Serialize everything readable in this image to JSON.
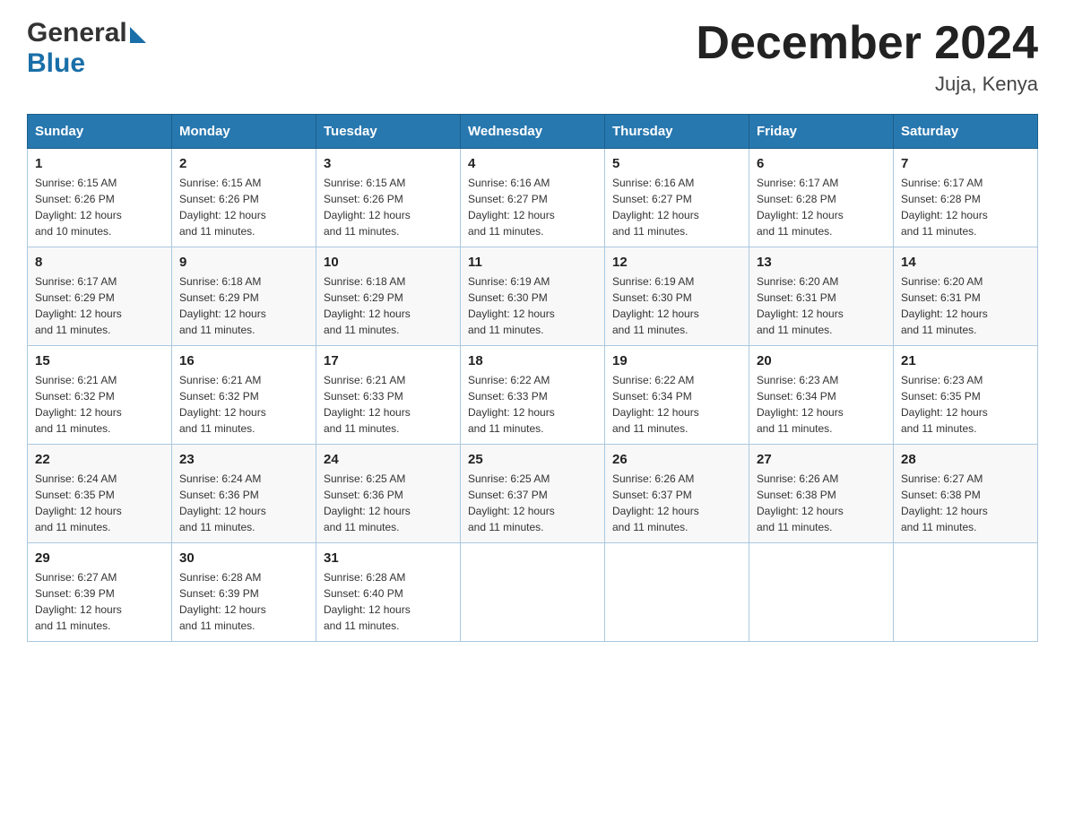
{
  "header": {
    "title": "December 2024",
    "location": "Juja, Kenya",
    "logo_general": "General",
    "logo_blue": "Blue"
  },
  "calendar": {
    "weekdays": [
      "Sunday",
      "Monday",
      "Tuesday",
      "Wednesday",
      "Thursday",
      "Friday",
      "Saturday"
    ],
    "weeks": [
      [
        {
          "day": "1",
          "sunrise": "6:15 AM",
          "sunset": "6:26 PM",
          "daylight": "12 hours and 10 minutes."
        },
        {
          "day": "2",
          "sunrise": "6:15 AM",
          "sunset": "6:26 PM",
          "daylight": "12 hours and 11 minutes."
        },
        {
          "day": "3",
          "sunrise": "6:15 AM",
          "sunset": "6:26 PM",
          "daylight": "12 hours and 11 minutes."
        },
        {
          "day": "4",
          "sunrise": "6:16 AM",
          "sunset": "6:27 PM",
          "daylight": "12 hours and 11 minutes."
        },
        {
          "day": "5",
          "sunrise": "6:16 AM",
          "sunset": "6:27 PM",
          "daylight": "12 hours and 11 minutes."
        },
        {
          "day": "6",
          "sunrise": "6:17 AM",
          "sunset": "6:28 PM",
          "daylight": "12 hours and 11 minutes."
        },
        {
          "day": "7",
          "sunrise": "6:17 AM",
          "sunset": "6:28 PM",
          "daylight": "12 hours and 11 minutes."
        }
      ],
      [
        {
          "day": "8",
          "sunrise": "6:17 AM",
          "sunset": "6:29 PM",
          "daylight": "12 hours and 11 minutes."
        },
        {
          "day": "9",
          "sunrise": "6:18 AM",
          "sunset": "6:29 PM",
          "daylight": "12 hours and 11 minutes."
        },
        {
          "day": "10",
          "sunrise": "6:18 AM",
          "sunset": "6:29 PM",
          "daylight": "12 hours and 11 minutes."
        },
        {
          "day": "11",
          "sunrise": "6:19 AM",
          "sunset": "6:30 PM",
          "daylight": "12 hours and 11 minutes."
        },
        {
          "day": "12",
          "sunrise": "6:19 AM",
          "sunset": "6:30 PM",
          "daylight": "12 hours and 11 minutes."
        },
        {
          "day": "13",
          "sunrise": "6:20 AM",
          "sunset": "6:31 PM",
          "daylight": "12 hours and 11 minutes."
        },
        {
          "day": "14",
          "sunrise": "6:20 AM",
          "sunset": "6:31 PM",
          "daylight": "12 hours and 11 minutes."
        }
      ],
      [
        {
          "day": "15",
          "sunrise": "6:21 AM",
          "sunset": "6:32 PM",
          "daylight": "12 hours and 11 minutes."
        },
        {
          "day": "16",
          "sunrise": "6:21 AM",
          "sunset": "6:32 PM",
          "daylight": "12 hours and 11 minutes."
        },
        {
          "day": "17",
          "sunrise": "6:21 AM",
          "sunset": "6:33 PM",
          "daylight": "12 hours and 11 minutes."
        },
        {
          "day": "18",
          "sunrise": "6:22 AM",
          "sunset": "6:33 PM",
          "daylight": "12 hours and 11 minutes."
        },
        {
          "day": "19",
          "sunrise": "6:22 AM",
          "sunset": "6:34 PM",
          "daylight": "12 hours and 11 minutes."
        },
        {
          "day": "20",
          "sunrise": "6:23 AM",
          "sunset": "6:34 PM",
          "daylight": "12 hours and 11 minutes."
        },
        {
          "day": "21",
          "sunrise": "6:23 AM",
          "sunset": "6:35 PM",
          "daylight": "12 hours and 11 minutes."
        }
      ],
      [
        {
          "day": "22",
          "sunrise": "6:24 AM",
          "sunset": "6:35 PM",
          "daylight": "12 hours and 11 minutes."
        },
        {
          "day": "23",
          "sunrise": "6:24 AM",
          "sunset": "6:36 PM",
          "daylight": "12 hours and 11 minutes."
        },
        {
          "day": "24",
          "sunrise": "6:25 AM",
          "sunset": "6:36 PM",
          "daylight": "12 hours and 11 minutes."
        },
        {
          "day": "25",
          "sunrise": "6:25 AM",
          "sunset": "6:37 PM",
          "daylight": "12 hours and 11 minutes."
        },
        {
          "day": "26",
          "sunrise": "6:26 AM",
          "sunset": "6:37 PM",
          "daylight": "12 hours and 11 minutes."
        },
        {
          "day": "27",
          "sunrise": "6:26 AM",
          "sunset": "6:38 PM",
          "daylight": "12 hours and 11 minutes."
        },
        {
          "day": "28",
          "sunrise": "6:27 AM",
          "sunset": "6:38 PM",
          "daylight": "12 hours and 11 minutes."
        }
      ],
      [
        {
          "day": "29",
          "sunrise": "6:27 AM",
          "sunset": "6:39 PM",
          "daylight": "12 hours and 11 minutes."
        },
        {
          "day": "30",
          "sunrise": "6:28 AM",
          "sunset": "6:39 PM",
          "daylight": "12 hours and 11 minutes."
        },
        {
          "day": "31",
          "sunrise": "6:28 AM",
          "sunset": "6:40 PM",
          "daylight": "12 hours and 11 minutes."
        },
        null,
        null,
        null,
        null
      ]
    ],
    "sunrise_label": "Sunrise:",
    "sunset_label": "Sunset:",
    "daylight_label": "Daylight:"
  }
}
